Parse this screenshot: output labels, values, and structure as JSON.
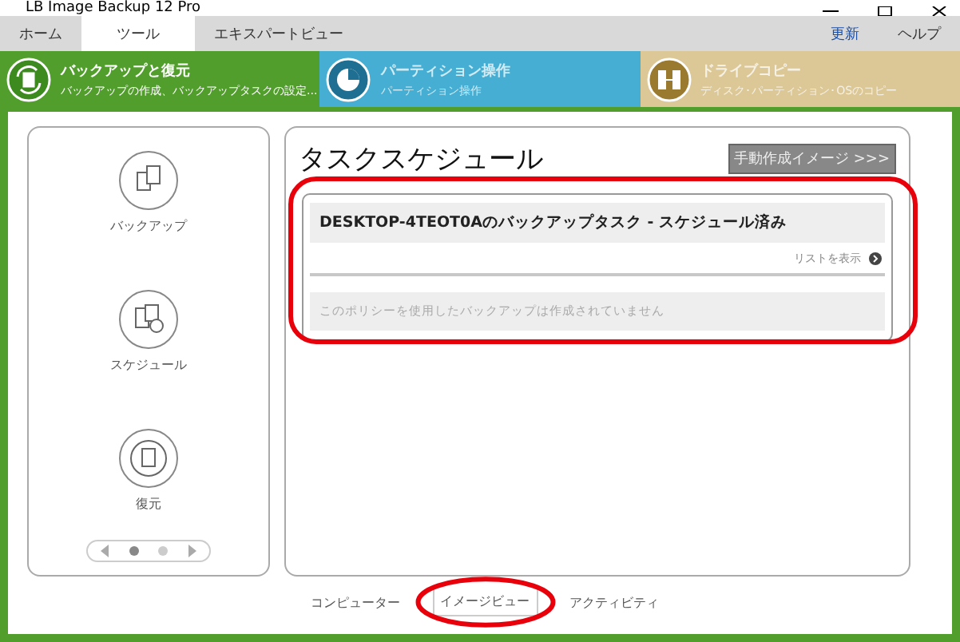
{
  "window": {
    "title": "LB Image Backup 12 Pro"
  },
  "menu_tabs": [
    {
      "label": "ホーム",
      "selected": false
    },
    {
      "label": "ツール",
      "selected": true
    },
    {
      "label": "エキスパートビュー",
      "selected": false
    }
  ],
  "menu_links": [
    "更新",
    "ヘルプ"
  ],
  "modules": [
    {
      "kind": "backup",
      "title": "バックアップと復元",
      "subtitle": "バックアップの作成、バックアップタスクの設定...",
      "selected": true,
      "color": "#519e2c"
    },
    {
      "kind": "partition",
      "title": "パーティション操作",
      "subtitle": "パーティション操作",
      "selected": false,
      "color": "#45aed2"
    },
    {
      "kind": "copy",
      "title": "ドライブコピー",
      "subtitle": "ディスク･パーティション･OSのコピー",
      "selected": false,
      "color": "#dcc796"
    }
  ],
  "sidebar": {
    "items": [
      {
        "kind": "backup",
        "label": "バックアップ"
      },
      {
        "kind": "schedule",
        "label": "スケジュール"
      },
      {
        "kind": "restore",
        "label": "復元"
      }
    ],
    "pager": [
      {
        "selected": true
      },
      {
        "selected": false
      }
    ]
  },
  "main": {
    "title": "タスクスケジュール",
    "manual_button": "手動作成イメージ >>>",
    "task": {
      "title": "DESKTOP-4TEOT0Aのバックアップタスク - スケジュール済み",
      "list_link": "リストを表示",
      "empty_message": "このポリシーを使用したバックアップは作成されていません"
    }
  },
  "view_tabs": [
    {
      "label": "コンピューター",
      "selected": false
    },
    {
      "label": "イメージビュー",
      "selected": true
    },
    {
      "label": "アクティビティ",
      "selected": false
    }
  ]
}
